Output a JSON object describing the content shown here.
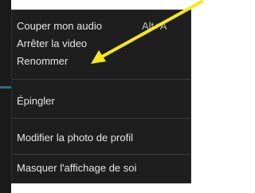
{
  "menu": {
    "items": [
      {
        "label": "Couper mon audio",
        "shortcut": "Alt+A"
      },
      {
        "label": "Arrêter la video"
      },
      {
        "label": "Renommer"
      },
      {
        "label": "Épingler"
      },
      {
        "label": "Modifier la photo de profil"
      },
      {
        "label": "Masquer l'affichage de soi"
      }
    ]
  },
  "colors": {
    "menu_background": "#1e1e1e",
    "menu_text": "#e6e6e6",
    "divider": "#3a3a3a",
    "annotation_arrow": "#f2ea1f"
  },
  "icons": {
    "annotation": "yellow-arrow-icon"
  }
}
